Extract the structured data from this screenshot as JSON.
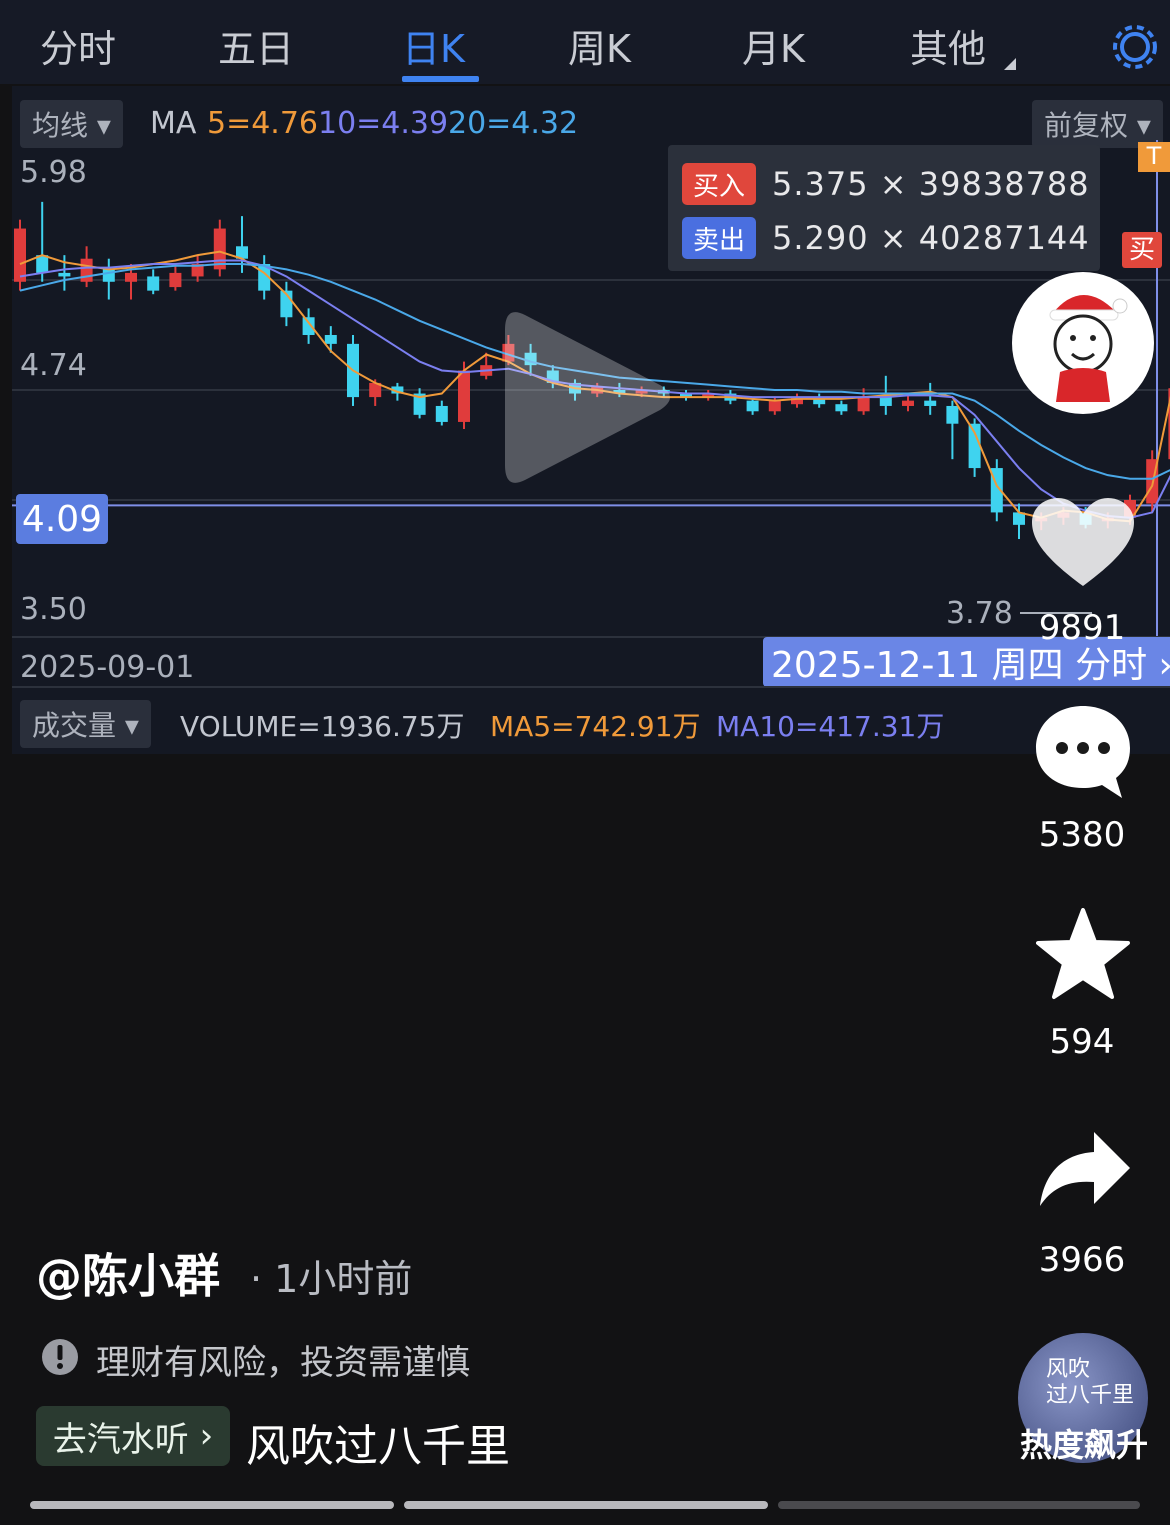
{
  "tabs": [
    "分时",
    "五日",
    "日K",
    "周K",
    "月K",
    "其他"
  ],
  "active_tab": "日K",
  "chart_toolbar": {
    "ma_dropdown": "均线",
    "ma_prefix": "MA",
    "ma5": "5=4.76",
    "ma10": "10=4.39",
    "ma20": "20=4.32",
    "adjust_dropdown": "前复权"
  },
  "order_popup": {
    "buy_label": "买入",
    "buy_value": "5.375 × 39838788",
    "sell_label": "卖出",
    "sell_value": "5.290 × 40287144"
  },
  "y_labels": {
    "top": "5.98",
    "mid": "4.74",
    "low": "3.50"
  },
  "crosshair_price": "4.09",
  "min_marker": "3.78",
  "x_start_date": "2025-09-01",
  "crosshair_date": "2025-12-11 周四 分时 ›",
  "volume_bar": {
    "dropdown": "成交量",
    "volume": "VOLUME=1936.75万",
    "ma5": "MA5=742.91万",
    "ma10": "MA10=417.31万"
  },
  "edge_tags": {
    "buy": "买",
    "top": "T"
  },
  "colors": {
    "up": "#e03c3c",
    "down": "#3fd3ef",
    "ma5": "#f09a3a",
    "ma10": "#7b7ff0",
    "ma20": "#4aa8e8",
    "accent": "#3f83f1"
  },
  "chart_data": {
    "type": "candlestick",
    "ylim": [
      3.5,
      5.98
    ],
    "series": [
      {
        "name": "MA5",
        "values": [
          5.45,
          5.5,
          5.46,
          5.44,
          5.42,
          5.43,
          5.45,
          5.47,
          5.5,
          5.52,
          5.48,
          5.4,
          5.28,
          5.12,
          4.96,
          4.85,
          4.78,
          4.73,
          4.7,
          4.72,
          4.85,
          4.94,
          4.9,
          4.83,
          4.78,
          4.75,
          4.74,
          4.72,
          4.71,
          4.7,
          4.7,
          4.7,
          4.7,
          4.69,
          4.68,
          4.69,
          4.69,
          4.69,
          4.7,
          4.71,
          4.72,
          4.73,
          4.7,
          4.5,
          4.2,
          4.05,
          4.02,
          4.06,
          4.05,
          4.01,
          4.0,
          4.2,
          4.8
        ]
      },
      {
        "name": "MA10",
        "values": [
          5.38,
          5.4,
          5.42,
          5.43,
          5.43,
          5.44,
          5.45,
          5.45,
          5.46,
          5.47,
          5.47,
          5.44,
          5.38,
          5.3,
          5.22,
          5.14,
          5.06,
          4.98,
          4.9,
          4.85,
          4.84,
          4.85,
          4.86,
          4.83,
          4.79,
          4.77,
          4.76,
          4.75,
          4.74,
          4.73,
          4.72,
          4.72,
          4.71,
          4.7,
          4.7,
          4.7,
          4.7,
          4.7,
          4.7,
          4.7,
          4.71,
          4.71,
          4.7,
          4.6,
          4.45,
          4.3,
          4.18,
          4.1,
          4.06,
          4.03,
          4.02,
          4.05,
          4.3
        ]
      },
      {
        "name": "MA20",
        "values": [
          5.3,
          5.33,
          5.36,
          5.38,
          5.4,
          5.42,
          5.43,
          5.44,
          5.44,
          5.45,
          5.45,
          5.44,
          5.42,
          5.39,
          5.35,
          5.3,
          5.25,
          5.19,
          5.13,
          5.08,
          5.03,
          4.98,
          4.94,
          4.9,
          4.87,
          4.85,
          4.83,
          4.81,
          4.8,
          4.79,
          4.78,
          4.77,
          4.76,
          4.75,
          4.74,
          4.74,
          4.73,
          4.73,
          4.72,
          4.72,
          4.72,
          4.72,
          4.72,
          4.68,
          4.6,
          4.51,
          4.43,
          4.36,
          4.3,
          4.26,
          4.24,
          4.24,
          4.3
        ]
      }
    ],
    "candles": [
      [
        5.35,
        5.65,
        5.7,
        5.3
      ],
      [
        5.5,
        5.4,
        5.8,
        5.35
      ],
      [
        5.4,
        5.38,
        5.5,
        5.3
      ],
      [
        5.35,
        5.48,
        5.55,
        5.32
      ],
      [
        5.42,
        5.35,
        5.48,
        5.25
      ],
      [
        5.35,
        5.4,
        5.45,
        5.25
      ],
      [
        5.38,
        5.3,
        5.42,
        5.28
      ],
      [
        5.32,
        5.4,
        5.45,
        5.3
      ],
      [
        5.38,
        5.45,
        5.5,
        5.35
      ],
      [
        5.42,
        5.65,
        5.7,
        5.38
      ],
      [
        5.55,
        5.48,
        5.72,
        5.4
      ],
      [
        5.45,
        5.3,
        5.5,
        5.25
      ],
      [
        5.3,
        5.15,
        5.35,
        5.1
      ],
      [
        5.15,
        5.05,
        5.2,
        5.0
      ],
      [
        5.05,
        5.0,
        5.1,
        4.95
      ],
      [
        5.0,
        4.7,
        5.05,
        4.65
      ],
      [
        4.7,
        4.78,
        4.8,
        4.65
      ],
      [
        4.76,
        4.72,
        4.78,
        4.68
      ],
      [
        4.72,
        4.6,
        4.75,
        4.58
      ],
      [
        4.65,
        4.56,
        4.68,
        4.54
      ],
      [
        4.56,
        4.85,
        4.9,
        4.52
      ],
      [
        4.82,
        4.88,
        4.95,
        4.8
      ],
      [
        4.9,
        5.0,
        5.05,
        4.88
      ],
      [
        4.95,
        4.88,
        5.0,
        4.82
      ],
      [
        4.85,
        4.78,
        4.88,
        4.75
      ],
      [
        4.78,
        4.72,
        4.8,
        4.68
      ],
      [
        4.72,
        4.76,
        4.78,
        4.7
      ],
      [
        4.74,
        4.72,
        4.78,
        4.7
      ],
      [
        4.72,
        4.74,
        4.76,
        4.7
      ],
      [
        4.74,
        4.72,
        4.76,
        4.7
      ],
      [
        4.72,
        4.7,
        4.74,
        4.68
      ],
      [
        4.7,
        4.72,
        4.74,
        4.68
      ],
      [
        4.72,
        4.68,
        4.74,
        4.66
      ],
      [
        4.68,
        4.62,
        4.7,
        4.6
      ],
      [
        4.62,
        4.68,
        4.7,
        4.6
      ],
      [
        4.66,
        4.7,
        4.72,
        4.64
      ],
      [
        4.7,
        4.66,
        4.72,
        4.64
      ],
      [
        4.66,
        4.62,
        4.68,
        4.6
      ],
      [
        4.62,
        4.7,
        4.75,
        4.6
      ],
      [
        4.7,
        4.65,
        4.82,
        4.6
      ],
      [
        4.65,
        4.68,
        4.72,
        4.62
      ],
      [
        4.68,
        4.65,
        4.78,
        4.6
      ],
      [
        4.65,
        4.55,
        4.68,
        4.35
      ],
      [
        4.55,
        4.3,
        4.58,
        4.25
      ],
      [
        4.3,
        4.05,
        4.35,
        4.0
      ],
      [
        4.05,
        3.98,
        4.1,
        3.9
      ],
      [
        4.0,
        4.02,
        4.05,
        3.95
      ],
      [
        4.02,
        4.05,
        4.08,
        3.98
      ],
      [
        4.05,
        3.98,
        4.08,
        3.96
      ],
      [
        4.0,
        4.02,
        4.05,
        3.96
      ],
      [
        4.02,
        4.12,
        4.15,
        3.98
      ],
      [
        4.1,
        4.35,
        4.4,
        4.05
      ],
      [
        4.35,
        4.75,
        4.82,
        4.3
      ]
    ]
  },
  "social": {
    "likes": "9891",
    "comments": "5380",
    "favorites": "594",
    "shares": "3966",
    "music_caption": "热度飙升"
  },
  "post": {
    "author": "@陈小群",
    "time": "· 1小时前",
    "warning": "理财有风险，投资需谨慎",
    "music_button": "去汽水听",
    "music_title": "风吹过八千里",
    "music_cover_text": "风吹\n过八千里"
  }
}
